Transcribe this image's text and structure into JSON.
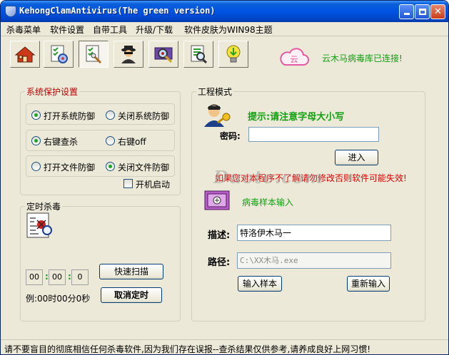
{
  "window": {
    "title": "KehongClamAntivirus(The green version)"
  },
  "menu": [
    "杀毒菜单",
    "软件设置",
    "自带工具",
    "升级/下载",
    "软件皮肤为WIN98主题"
  ],
  "toolbar": {
    "icons": [
      "home-icon",
      "scan-file-icon",
      "tools-icon",
      "incognito-agent-icon",
      "virus-scan-icon",
      "search-doc-icon",
      "update-bulb-icon"
    ],
    "pressed_index": 2,
    "cloud_icon_text": "云",
    "cloud_status": "云木马病毒库已连接!"
  },
  "protection": {
    "title": "系统保护设置",
    "rows": [
      {
        "left": "打开系统防御",
        "right": "关闭系统防御",
        "selected": "left"
      },
      {
        "left": "右键查杀",
        "right": "右键off",
        "selected": "left"
      },
      {
        "left": "打开文件防御",
        "right": "关闭文件防御",
        "selected": "right"
      }
    ],
    "autostart_label": "开机启动",
    "autostart_checked": false
  },
  "timer": {
    "title": "定时杀毒",
    "hour": "00",
    "minute": "00",
    "second": "0",
    "example": "例:00时00分0秒",
    "quick_scan": "快速扫描",
    "cancel_timer": "取消定时"
  },
  "engineering": {
    "title": "工程模式",
    "hint": "提示:请注意字母大小写",
    "password_label": "密码:",
    "password_value": "",
    "enter_button": "进入",
    "warning": "如果您对本程序不了解请勿修改否则软件可能失效!",
    "sample_input_label": "病毒样本输入",
    "desc_label": "描述:",
    "desc_value": "特洛伊木马一",
    "path_label": "路径:",
    "path_placeholder": "C:\\XX木马.exe",
    "input_sample_button": "输入样本",
    "reinput_button": "重新输入"
  },
  "statusbar": {
    "text": "请不要盲目的彻底相信任何杀毒软件,因为我们存在误报--查杀结果仅供参考,请养成良好上网习惯!"
  },
  "watermark": {
    "text": "Duote.com"
  },
  "colors": {
    "accent_green": "#12a012",
    "title_red": "#c00000",
    "warning_red": "#e00000",
    "title_blue": "#0054e3"
  }
}
